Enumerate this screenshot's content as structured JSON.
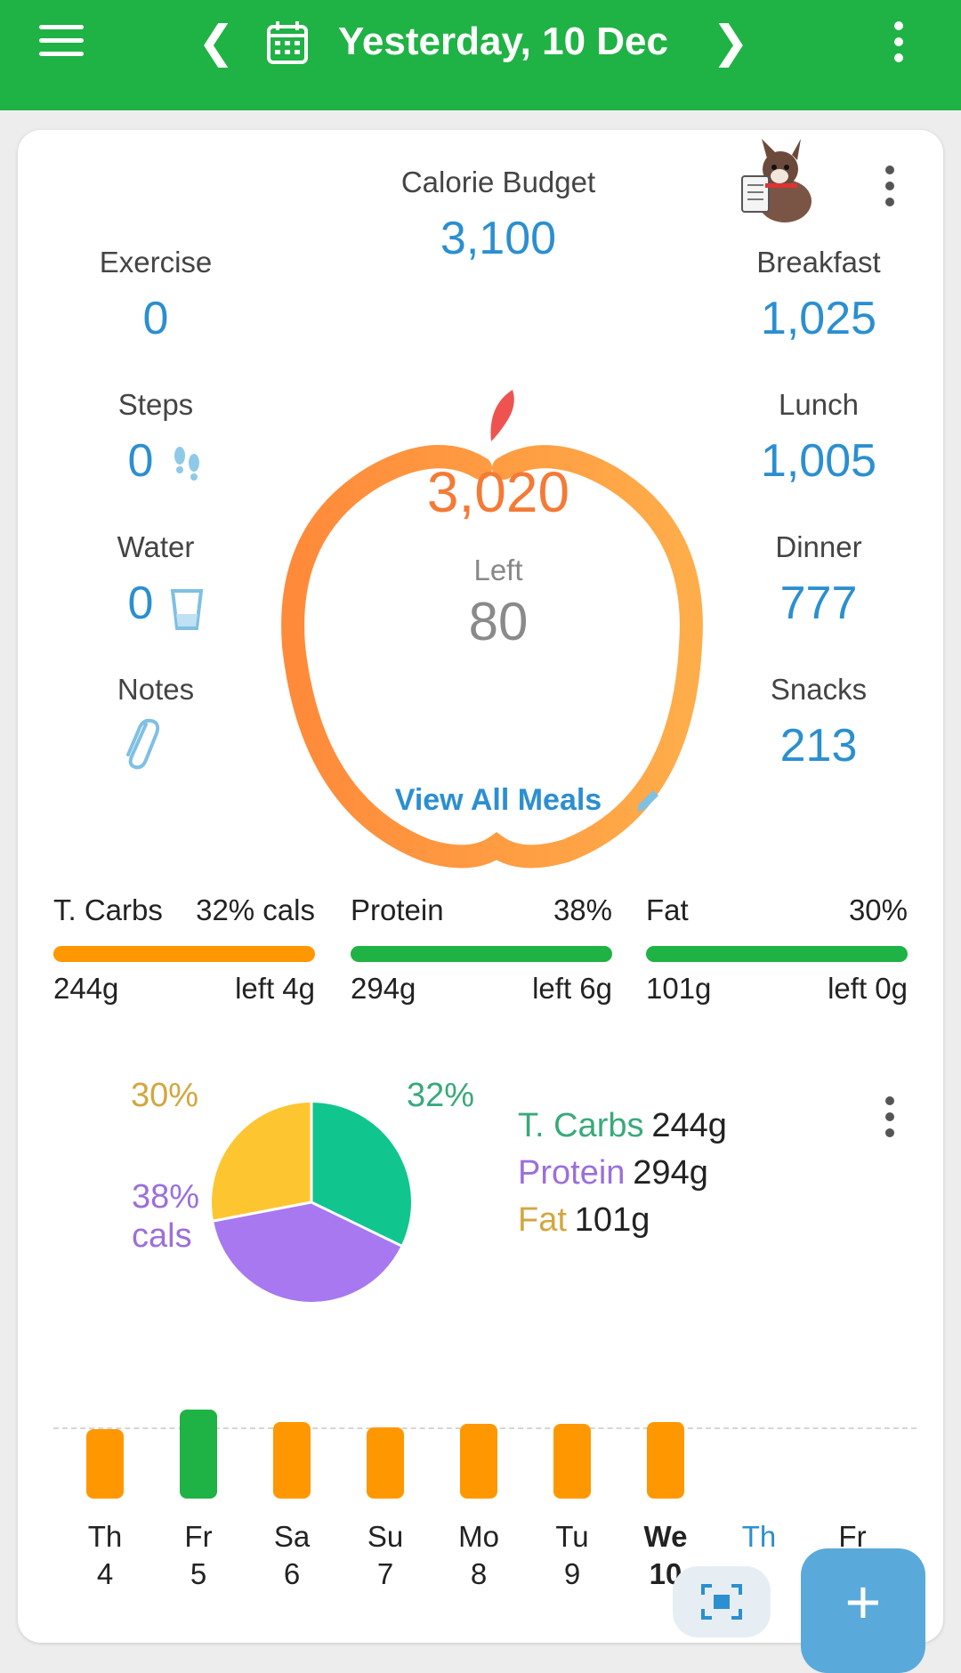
{
  "header": {
    "date_label": "Yesterday, 10 Dec",
    "prev_icon": "chevron-left-icon",
    "next_icon": "chevron-right-icon",
    "calendar_icon": "calendar-icon",
    "menu_icon": "hamburger-menu-icon",
    "more_icon": "more-vert-icon",
    "color": "#1fb244"
  },
  "summary": {
    "budget_label": "Calorie Budget",
    "budget_value": "3,100",
    "consumed_value": "3,020",
    "left_label": "Left",
    "left_value": "80",
    "view_all_label": "View All Meals",
    "left_column": [
      {
        "label": "Exercise",
        "value": "0"
      },
      {
        "label": "Steps",
        "value": "0"
      },
      {
        "label": "Water",
        "value": "0"
      },
      {
        "label": "Notes",
        "value": ""
      }
    ],
    "right_column": [
      {
        "label": "Breakfast",
        "value": "1,025"
      },
      {
        "label": "Lunch",
        "value": "1,005"
      },
      {
        "label": "Dinner",
        "value": "777"
      },
      {
        "label": "Snacks",
        "value": "213"
      }
    ]
  },
  "macros": [
    {
      "name": "T. Carbs",
      "pct": "32% cals",
      "grams": "244g",
      "left": "left 4g",
      "color": "#ff9800"
    },
    {
      "name": "Protein",
      "pct": "38%",
      "grams": "294g",
      "left": "left 6g",
      "color": "#1fb244"
    },
    {
      "name": "Fat",
      "pct": "30%",
      "grams": "101g",
      "left": "left 0g",
      "color": "#1fb244"
    }
  ],
  "pie": {
    "label_fat": "30%",
    "label_carbs": "32%",
    "label_protein_1": "38%",
    "label_protein_2": "cals",
    "legend": [
      {
        "name": "T. Carbs",
        "value": "244g",
        "color": "#3aa97a"
      },
      {
        "name": "Protein",
        "value": "294g",
        "color": "#9b6fdc"
      },
      {
        "name": "Fat",
        "value": "101g",
        "color": "#d2a73e"
      }
    ],
    "colors": {
      "carbs": "#11c58f",
      "protein": "#a878f0",
      "fat": "#fdc631"
    }
  },
  "week": {
    "days": [
      {
        "dow": "Th",
        "num": "4",
        "level": 0.78,
        "color": "#ff9800"
      },
      {
        "dow": "Fr",
        "num": "5",
        "level": 1.0,
        "color": "#1fb244"
      },
      {
        "dow": "Sa",
        "num": "6",
        "level": 0.86,
        "color": "#ff9800"
      },
      {
        "dow": "Su",
        "num": "7",
        "level": 0.8,
        "color": "#ff9800"
      },
      {
        "dow": "Mo",
        "num": "8",
        "level": 0.84,
        "color": "#ff9800"
      },
      {
        "dow": "Tu",
        "num": "9",
        "level": 0.84,
        "color": "#ff9800"
      },
      {
        "dow": "We",
        "num": "10",
        "level": 0.86,
        "color": "#ff9800"
      },
      {
        "dow": "Th",
        "num": "",
        "level": 0,
        "color": "#2b8fd0"
      },
      {
        "dow": "Fr",
        "num": "",
        "level": 0,
        "color": "#222"
      }
    ]
  },
  "fab_label": "+"
}
